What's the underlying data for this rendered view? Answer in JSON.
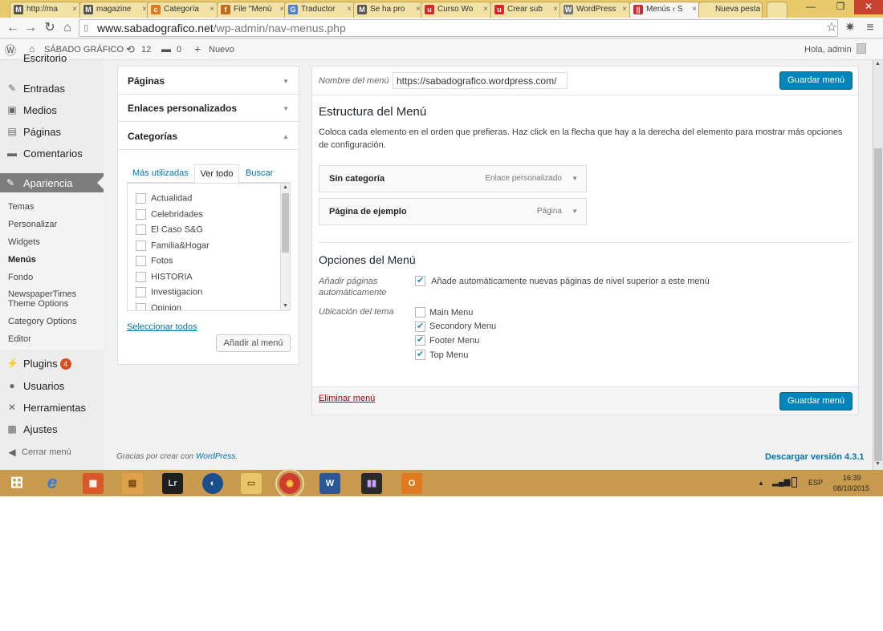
{
  "browser": {
    "tabs": [
      {
        "label": "http://ma",
        "fav": "M",
        "color": "#555555"
      },
      {
        "label": "magazine",
        "fav": "M",
        "color": "#555555"
      },
      {
        "label": "Categoría",
        "fav": "c",
        "color": "#e07a1f"
      },
      {
        "label": "File \"Menú",
        "fav": "f",
        "color": "#c26a1a"
      },
      {
        "label": "Traductor",
        "fav": "G",
        "color": "#4a7fd8"
      },
      {
        "label": "Se ha pro",
        "fav": "M",
        "color": "#555555"
      },
      {
        "label": "Curso Wo",
        "fav": "u",
        "color": "#d9262a"
      },
      {
        "label": "Crear sub",
        "fav": "u",
        "color": "#d9262a"
      },
      {
        "label": "WordPress",
        "fav": "W",
        "color": "#777777"
      },
      {
        "label": "Menús ‹ S",
        "fav": "||",
        "color": "#d9262a"
      },
      {
        "label": "Nueva pesta",
        "fav": "",
        "color": "#f2e2a6"
      }
    ],
    "active_tab_index": 9,
    "url_host": "www.sabadografico.net",
    "url_path": "/wp-admin/nav-menus.php"
  },
  "adminbar": {
    "site_name": "SÁBADO GRÁFICO",
    "updates": "12",
    "comments": "0",
    "new_label": "Nuevo",
    "greeting": "Hola, admin"
  },
  "sidebar": {
    "top_partial": "Escritorio",
    "items_top": [
      {
        "label": "Entradas",
        "icon": "pin-icon"
      },
      {
        "label": "Medios",
        "icon": "media-icon"
      },
      {
        "label": "Páginas",
        "icon": "page-icon"
      },
      {
        "label": "Comentarios",
        "icon": "comment-icon"
      }
    ],
    "active": "Apariencia",
    "submenu": [
      "Temas",
      "Personalizar",
      "Widgets",
      "Menús",
      "Fondo",
      "NewspaperTimes Theme Options",
      "Category Options",
      "Editor"
    ],
    "current_submenu": "Menús",
    "plugins_label": "Plugins",
    "plugins_badge": "4",
    "items_bottom": [
      {
        "label": "Usuarios",
        "icon": "users-icon"
      },
      {
        "label": "Herramientas",
        "icon": "tools-icon"
      },
      {
        "label": "Ajustes",
        "icon": "settings-icon"
      }
    ],
    "collapse_label": "Cerrar menú"
  },
  "accordion": {
    "pages": "Páginas",
    "custom_links": "Enlaces personalizados",
    "categories": "Categorías",
    "tabs": [
      "Más utilizadas",
      "Ver todo",
      "Buscar"
    ],
    "active_tab": "Ver todo",
    "category_items": [
      "Actualidad",
      "Celebridades",
      "El Caso S&G",
      "Familia&Hogar",
      "Fotos",
      "HISTORIA",
      "Investigacion",
      "Opinion"
    ],
    "select_all": "Seleccionar todos",
    "add_to_menu": "Añadir al menú"
  },
  "menu_editor": {
    "name_label": "Nombre del menú",
    "name_value": "https://sabadografico.wordpress.com/",
    "save_label": "Guardar menú",
    "structure_title": "Estructura del Menú",
    "structure_help": "Coloca cada elemento en el orden que prefieras. Haz click en la flecha que hay a la derecha del elemento para mostrar más opciones de configuración.",
    "items": [
      {
        "title": "Sin categoría",
        "kind": "Enlace personalizado"
      },
      {
        "title": "Página de ejemplo",
        "kind": "Página"
      }
    ],
    "options_title": "Opciones del Menú",
    "auto_add_label": "Añadir páginas automáticamente",
    "auto_add_text": "Añade automáticamente nuevas páginas de nivel superior a este menú",
    "auto_add_checked": true,
    "location_label": "Ubicación del tema",
    "locations": [
      {
        "label": "Main Menu",
        "checked": false
      },
      {
        "label": "Secondory Menu",
        "checked": true
      },
      {
        "label": "Footer Menu",
        "checked": true
      },
      {
        "label": "Top Menu",
        "checked": true
      }
    ],
    "delete_label": "Eliminar menú"
  },
  "footer": {
    "thanks_prefix": "Gracias por crear con ",
    "thanks_link": "WordPress",
    "thanks_suffix": ".",
    "version": "Descargar versión 4.3.1"
  },
  "taskbar": {
    "lang": "ESP",
    "time": "16:39",
    "date": "08/10/2015"
  },
  "colors": {
    "primary": "#0085ba",
    "link": "#0073aa",
    "taskbar": "#c89a4e",
    "tabbar": "#e8c96b",
    "badge": "#d54e21"
  }
}
